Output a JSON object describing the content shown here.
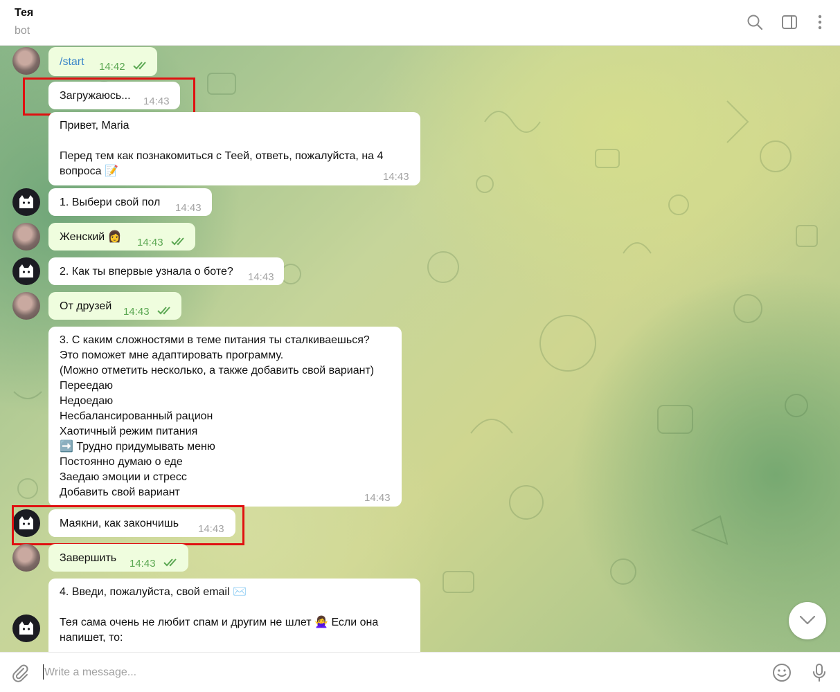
{
  "header": {
    "title": "Тея",
    "subtitle": "bot",
    "icons": [
      "search-icon",
      "sidebar-toggle-icon",
      "more-vertical-icon"
    ]
  },
  "messages": [
    {
      "id": "m1",
      "direction": "out",
      "text": "/start",
      "time": "14:42",
      "read": true
    },
    {
      "id": "m2",
      "direction": "in",
      "text": "Загружаюсь...",
      "time": "14:43"
    },
    {
      "id": "m3",
      "direction": "in",
      "lines": [
        "Привет, Maria",
        "",
        "Перед тем как познакомиться с Теей, ответь, пожалуйста, на 4",
        "вопроса 📝"
      ],
      "time": "14:43"
    },
    {
      "id": "m4",
      "direction": "in",
      "text": "1. Выбери свой пол",
      "time": "14:43"
    },
    {
      "id": "m5",
      "direction": "out",
      "text": "Женский 👩",
      "time": "14:43",
      "read": true
    },
    {
      "id": "m6",
      "direction": "in",
      "text": "2. Как ты впервые узнала о боте?",
      "time": "14:43"
    },
    {
      "id": "m7",
      "direction": "out",
      "text": "От друзей",
      "time": "14:43",
      "read": true
    },
    {
      "id": "m8",
      "direction": "in",
      "lines": [
        "3. С каким сложностями в теме питания ты сталкиваешься?",
        "Это поможет мне адаптировать программу.",
        "(Можно отметить несколько, а также добавить свой вариант)",
        "Переедаю",
        "Недоедаю",
        "Несбалансированный рацион",
        "Хаотичный режим питания",
        "➡️ Трудно придумывать меню",
        "Постоянно думаю о еде",
        "Заедаю эмоции и стресс",
        "Добавить свой вариант"
      ],
      "time": "14:43"
    },
    {
      "id": "m9",
      "direction": "in",
      "text": "Маякни, как закончишь",
      "time": "14:43"
    },
    {
      "id": "m10",
      "direction": "out",
      "text": "Завершить",
      "time": "14:43",
      "read": true
    },
    {
      "id": "m11",
      "direction": "in",
      "lines": [
        "4. Введи, пожалуйста, свой email ✉️",
        "",
        "Тея сама очень не любит спам и другим не шлет 🙅‍♀️ Если она",
        "напишет, то:"
      ]
    }
  ],
  "composer": {
    "placeholder": "Write a message...",
    "value": "",
    "icons": [
      "attach-icon",
      "emoji-icon",
      "microphone-icon"
    ]
  },
  "colors": {
    "incoming_bubble": "#ffffff",
    "outgoing_bubble": "#effdde",
    "read_check": "#5ca853",
    "command_link": "#3a85c9",
    "highlight_box": "#e01010"
  }
}
